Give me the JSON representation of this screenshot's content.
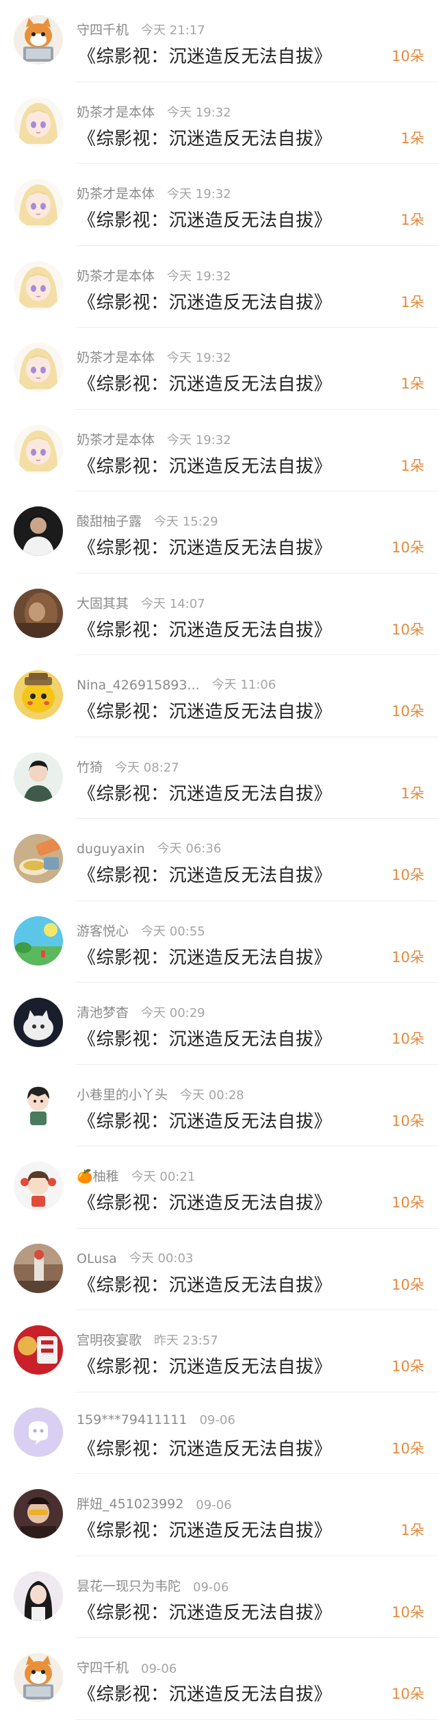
{
  "colors": {
    "gift": "#e58a3c",
    "username": "#8b8b8b",
    "time": "#a5a5a5",
    "title": "#222222",
    "divider": "#eeeeee"
  },
  "rows": [
    {
      "name": "守四千机",
      "time": "今天 21:17",
      "title": "《综影视：沉迷造反无法自拔》",
      "gift": "10朵",
      "avatar": "cat-laptop"
    },
    {
      "name": "奶茶才是本体",
      "time": "今天 19:32",
      "title": "《综影视：沉迷造反无法自拔》",
      "gift": "1朵",
      "avatar": "anime-girl"
    },
    {
      "name": "奶茶才是本体",
      "time": "今天 19:32",
      "title": "《综影视：沉迷造反无法自拔》",
      "gift": "1朵",
      "avatar": "anime-girl"
    },
    {
      "name": "奶茶才是本体",
      "time": "今天 19:32",
      "title": "《综影视：沉迷造反无法自拔》",
      "gift": "1朵",
      "avatar": "anime-girl"
    },
    {
      "name": "奶茶才是本体",
      "time": "今天 19:32",
      "title": "《综影视：沉迷造反无法自拔》",
      "gift": "1朵",
      "avatar": "anime-girl"
    },
    {
      "name": "奶茶才是本体",
      "time": "今天 19:32",
      "title": "《综影视：沉迷造反无法自拔》",
      "gift": "1朵",
      "avatar": "anime-girl"
    },
    {
      "name": "酸甜柚子露",
      "time": "今天 15:29",
      "title": "《综影视：沉迷造反无法自拔》",
      "gift": "10朵",
      "avatar": "dark-portrait"
    },
    {
      "name": "大固其其",
      "time": "今天 14:07",
      "title": "《综影视：沉迷造反无法自拔》",
      "gift": "10朵",
      "avatar": "brown-photo"
    },
    {
      "name": "Nina_426915893...",
      "time": "今天 11:06",
      "title": "《综影视：沉迷造反无法自拔》",
      "gift": "10朵",
      "avatar": "yellow-character"
    },
    {
      "name": "竹猗",
      "time": "今天 08:27",
      "title": "《综影视：沉迷造反无法自拔》",
      "gift": "1朵",
      "avatar": "boy-portrait"
    },
    {
      "name": "duguyaxin",
      "time": "今天 06:36",
      "title": "《综影视：沉迷造反无法自拔》",
      "gift": "10朵",
      "avatar": "food-photo"
    },
    {
      "name": "游客悦心",
      "time": "今天 00:55",
      "title": "《综影视：沉迷造反无法自拔》",
      "gift": "10朵",
      "avatar": "sky-landscape"
    },
    {
      "name": "清池梦杳",
      "time": "今天 00:29",
      "title": "《综影视：沉迷造反无法自拔》",
      "gift": "10朵",
      "avatar": "white-cat"
    },
    {
      "name": "小巷里的小丫头",
      "time": "今天 00:28",
      "title": "《综影视：沉迷造反无法自拔》",
      "gift": "10朵",
      "avatar": "cartoon-boy"
    },
    {
      "name": "🍊柚稚",
      "time": "今天 00:21",
      "title": "《综影视：沉迷造反无法自拔》",
      "gift": "10朵",
      "avatar": "cartoon-girl"
    },
    {
      "name": "OLusa",
      "time": "今天 00:03",
      "title": "《综影视：沉迷造反无法自拔》",
      "gift": "10朵",
      "avatar": "interior-photo"
    },
    {
      "name": "宫明夜宴歌",
      "time": "昨天 23:57",
      "title": "《综影视：沉迷造反无法自拔》",
      "gift": "10朵",
      "avatar": "red-festive"
    },
    {
      "name": "159***79411111",
      "time": "09-06",
      "title": "《综影视：沉迷造反无法自拔》",
      "gift": "10朵",
      "avatar": "default-chat"
    },
    {
      "name": "胖妞_451023992",
      "time": "09-06",
      "title": "《综影视：沉迷造反无法自拔》",
      "gift": "1朵",
      "avatar": "selfie"
    },
    {
      "name": "昙花一现只为韦陀",
      "time": "09-06",
      "title": "《综影视：沉迷造反无法自拔》",
      "gift": "10朵",
      "avatar": "girl-long-hair"
    },
    {
      "name": "守四千机",
      "time": "09-06",
      "title": "《综影视：沉迷造反无法自拔》",
      "gift": "10朵",
      "avatar": "cat-laptop"
    }
  ]
}
